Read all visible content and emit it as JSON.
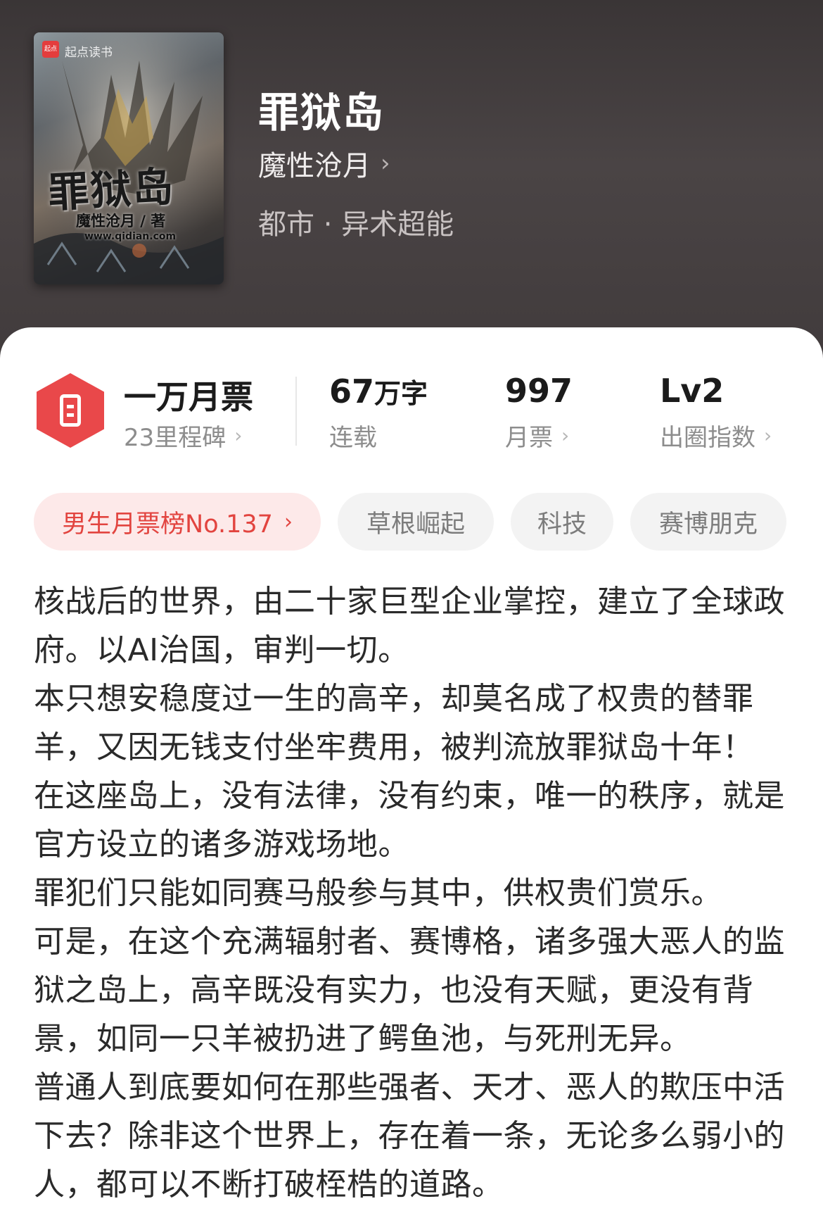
{
  "book": {
    "cover": {
      "publisher_badge": "起点",
      "publisher": "起点读书",
      "title": "罪狱岛",
      "author_line": "魔性沧月 / 著",
      "site": "www.qidian.com"
    },
    "title": "罪狱岛",
    "author": "魔性沧月",
    "genre": "都市 · 异术超能"
  },
  "stats": {
    "milestone": {
      "title": "一万月票",
      "sub": "23里程碑",
      "icon": "ticket-hexagon-icon"
    },
    "words": {
      "value": "67",
      "unit": "万字",
      "sub": "连载"
    },
    "monthly_votes": {
      "value": "997",
      "sub": "月票"
    },
    "popularity": {
      "value": "Lv2",
      "sub": "出圈指数"
    }
  },
  "tags": {
    "rank": "男生月票榜No.137",
    "items": [
      "草根崛起",
      "科技",
      "赛博朋克"
    ]
  },
  "description": [
    "核战后的世界，由二十家巨型企业掌控，建立了全球政府。以AI治国，审判一切。",
    "本只想安稳度过一生的高辛，却莫名成了权贵的替罪羊，又因无钱支付坐牢费用，被判流放罪狱岛十年！",
    "在这座岛上，没有法律，没有约束，唯一的秩序，就是官方设立的诸多游戏场地。",
    "罪犯们只能如同赛马般参与其中，供权贵们赏乐。",
    "可是，在这个充满辐射者、赛博格，诸多强大恶人的监狱之岛上，高辛既没有实力，也没有天赋，更没有背景，如同一只羊被扔进了鳄鱼池，与死刑无异。",
    "普通人到底要如何在那些强者、天才、恶人的欺压中活下去？除非这个世界上，存在着一条，无论多么弱小的人，都可以不断打破桎梏的道路。"
  ],
  "colors": {
    "header_bg": "#463f40",
    "accent_red": "#e9484a",
    "rank_tag_bg": "#fde9e9"
  }
}
